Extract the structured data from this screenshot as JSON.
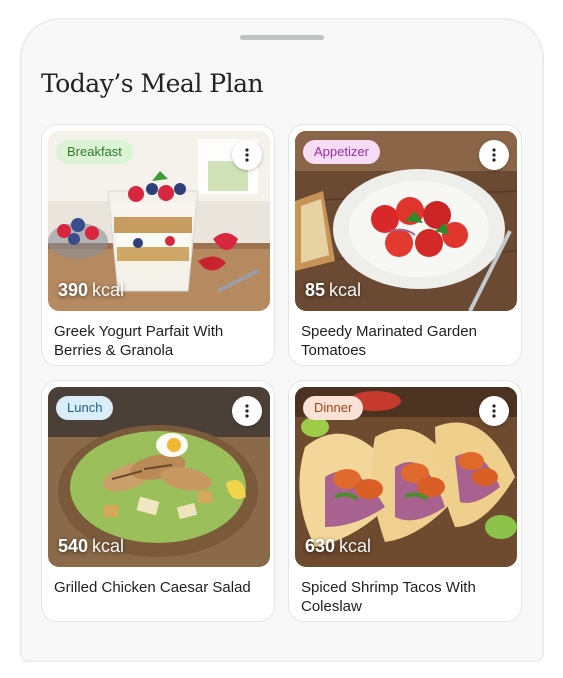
{
  "page": {
    "title": "Today’s Meal Plan"
  },
  "colors": {
    "breakfast_badge_bg": "#dcf4d6",
    "breakfast_badge_text": "#2f7a28",
    "appetizer_badge_bg": "#f7dcf6",
    "appetizer_badge_text": "#9b2ea3",
    "lunch_badge_bg": "#d9eef8",
    "lunch_badge_text": "#1d5f80",
    "dinner_badge_bg": "#fae3d6",
    "dinner_badge_text": "#a2441a"
  },
  "meals": [
    {
      "category": "Breakfast",
      "kcal": "390",
      "unit": "kcal",
      "name": "Greek Yogurt Parfait With Berries & Granola",
      "menu_icon": "more-vertical-icon"
    },
    {
      "category": "Appetizer",
      "kcal": "85",
      "unit": "kcal",
      "name": "Speedy Marinated Garden Tomatoes",
      "menu_icon": "more-vertical-icon"
    },
    {
      "category": "Lunch",
      "kcal": "540",
      "unit": "kcal",
      "name": "Grilled Chicken Caesar Salad",
      "menu_icon": "more-vertical-icon"
    },
    {
      "category": "Dinner",
      "kcal": "630",
      "unit": "kcal",
      "name": "Spiced Shrimp Tacos With Coleslaw",
      "menu_icon": "more-vertical-icon"
    }
  ]
}
